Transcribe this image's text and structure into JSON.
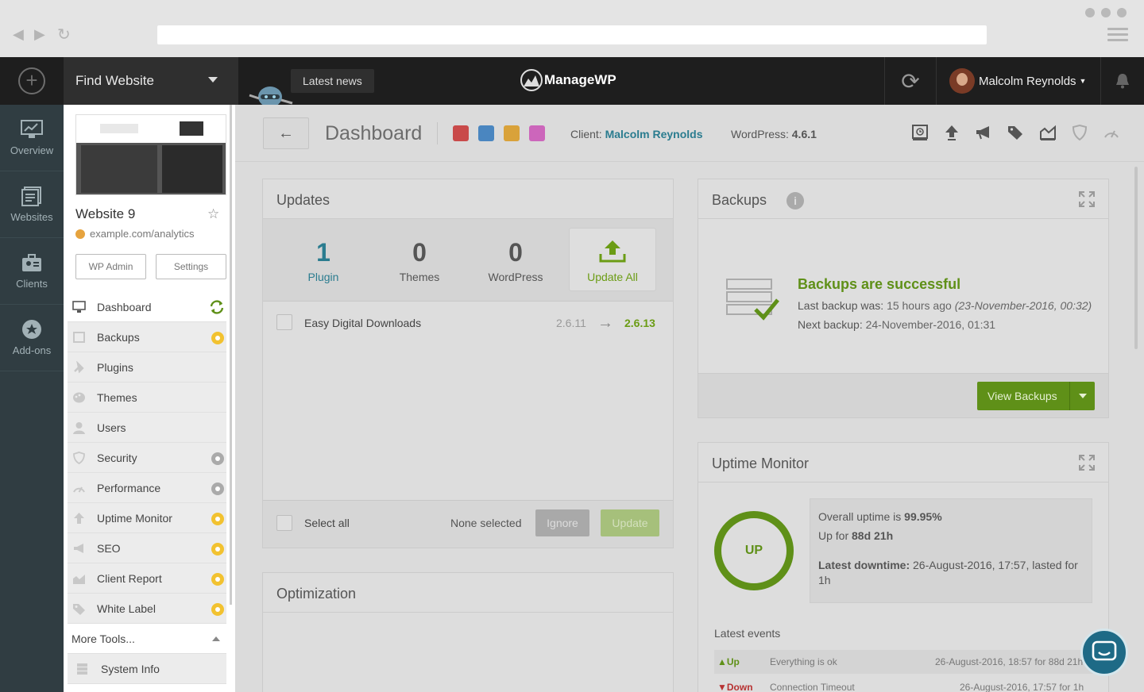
{
  "browser": {
    "menu_icon": "hamburger-icon"
  },
  "topbar": {
    "find_website": "Find Website",
    "latest_news": "Latest news",
    "logo_text": "ManageWP",
    "user_name": "Malcolm Reynolds"
  },
  "leftnav": {
    "items": [
      {
        "label": "Overview",
        "icon": "monitor-chart-icon"
      },
      {
        "label": "Websites",
        "icon": "websites-icon"
      },
      {
        "label": "Clients",
        "icon": "clients-icon"
      },
      {
        "label": "Add-ons",
        "icon": "addons-icon"
      }
    ]
  },
  "site": {
    "name": "Website 9",
    "url": "example.com/analytics",
    "wp_admin": "WP Admin",
    "settings": "Settings"
  },
  "menu": {
    "items": [
      {
        "label": "Dashboard",
        "badge": "sync"
      },
      {
        "label": "Backups",
        "badge": "gold"
      },
      {
        "label": "Plugins",
        "badge": ""
      },
      {
        "label": "Themes",
        "badge": ""
      },
      {
        "label": "Users",
        "badge": ""
      },
      {
        "label": "Security",
        "badge": "gray"
      },
      {
        "label": "Performance",
        "badge": "gray"
      },
      {
        "label": "Uptime Monitor",
        "badge": "gold"
      },
      {
        "label": "SEO",
        "badge": "gold"
      },
      {
        "label": "Client Report",
        "badge": "gold"
      },
      {
        "label": "White Label",
        "badge": "gold"
      }
    ],
    "more_tools": "More Tools...",
    "system_info": "System Info"
  },
  "dashbar": {
    "title": "Dashboard",
    "client_label": "Client:",
    "client_name": "Malcolm Reynolds",
    "wp_label": "WordPress:",
    "wp_version": "4.6.1",
    "swatches": [
      "#c94a4a",
      "#4a86c0",
      "#d9a23a",
      "#cc66bb"
    ]
  },
  "updates": {
    "title": "Updates",
    "tabs": [
      {
        "count": "1",
        "label": "Plugin"
      },
      {
        "count": "0",
        "label": "Themes"
      },
      {
        "count": "0",
        "label": "WordPress"
      }
    ],
    "update_all": "Update All",
    "plugin_name": "Easy Digital Downloads",
    "from_version": "2.6.11",
    "to_version": "2.6.13",
    "select_all": "Select all",
    "none_selected": "None selected",
    "ignore": "Ignore",
    "update": "Update"
  },
  "optimization": {
    "title": "Optimization"
  },
  "backups": {
    "title": "Backups",
    "status": "Backups are successful",
    "last_label": "Last backup was:",
    "last_rel": "15 hours ago",
    "last_abs": "(23-November-2016, 00:32)",
    "next_label": "Next backup:",
    "next_value": "24-November-2016, 01:31",
    "view_backups": "View Backups"
  },
  "uptime": {
    "title": "Uptime Monitor",
    "ring_label": "UP",
    "overall_label": "Overall uptime is",
    "overall_value": "99.95%",
    "up_for_label": "Up for",
    "up_for_value": "88d 21h",
    "latest_label": "Latest downtime:",
    "latest_value": "26-August-2016, 17:57, lasted for 1h",
    "events_title": "Latest events",
    "events": [
      {
        "state": "Up",
        "message": "Everything is ok",
        "time": "26-August-2016, 18:57 for 88d 21h"
      },
      {
        "state": "Down",
        "message": "Connection Timeout",
        "time": "26-August-2016, 17:57 for 1h"
      }
    ]
  }
}
